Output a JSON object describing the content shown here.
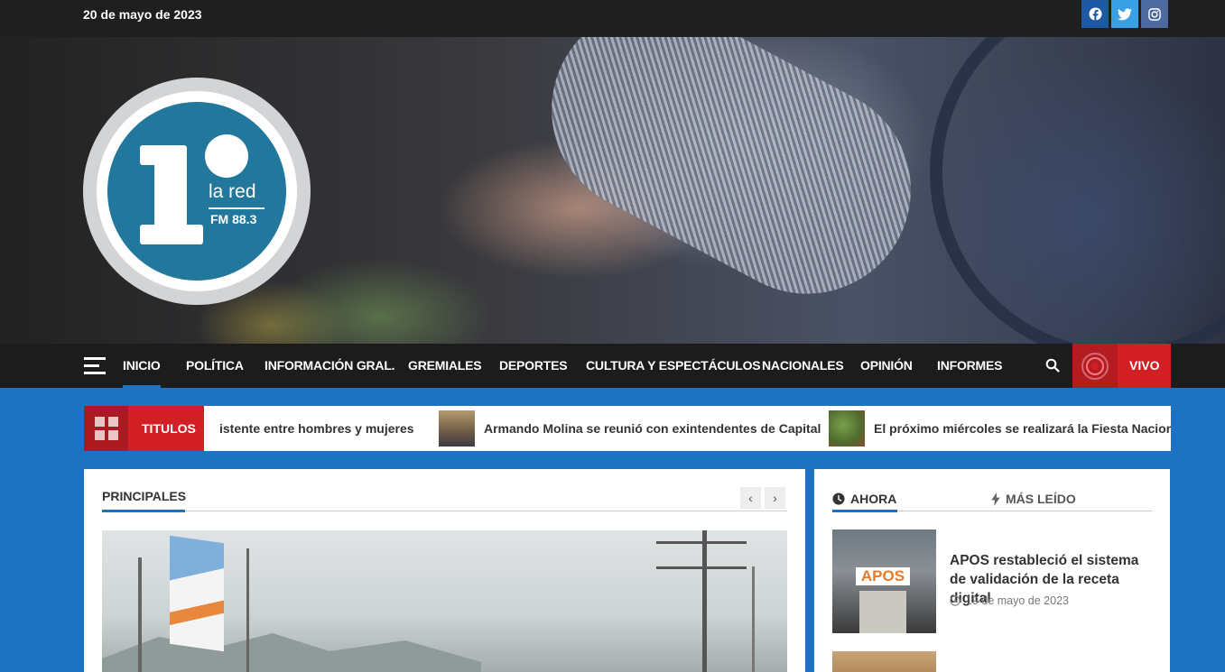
{
  "topbar": {
    "date": "20 de mayo de 2023",
    "social": [
      "facebook-icon",
      "twitter-icon",
      "instagram-icon"
    ]
  },
  "logo": {
    "text_line1": "la red",
    "text_line2": "FM 88.3"
  },
  "nav": {
    "items": [
      {
        "label": "INICIO",
        "active": true
      },
      {
        "label": "POLÍTICA"
      },
      {
        "label": "INFORMACIÓN GRAL."
      },
      {
        "label": "GREMIALES"
      },
      {
        "label": "DEPORTES"
      },
      {
        "label": "CULTURA Y ESPECTÁCULOS"
      },
      {
        "label": "NACIONALES"
      },
      {
        "label": "OPINIÓN"
      },
      {
        "label": "INFORMES"
      }
    ],
    "live_label": "VIVO"
  },
  "ticker": {
    "label": "TITULOS",
    "items": [
      "istente entre hombres y mujeres",
      "Armando Molina se reunió con exintendentes de Capital",
      "El próximo miércoles se realizará la Fiesta Nacional"
    ]
  },
  "main": {
    "section_title": "PRINCIPALES",
    "prev": "‹",
    "next": "›"
  },
  "side": {
    "tab_now": "AHORA",
    "tab_read": "MÁS LEÍDO",
    "news": [
      {
        "thumb_sign": "APOS",
        "title": "APOS restableció el sistema de validación de la receta digital",
        "date": "19 de mayo de 2023"
      }
    ]
  },
  "colors": {
    "brand_blue": "#1e72c2",
    "live_red": "#d21f26",
    "dark": "#1c1c1c"
  }
}
